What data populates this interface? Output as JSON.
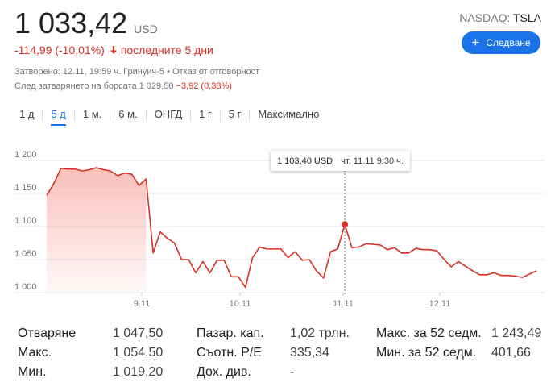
{
  "quote": {
    "price": "1 033,42",
    "currency": "USD",
    "exchange": "NASDAQ:",
    "symbol": "TSLA",
    "follow_label": "Следване",
    "change": "-114,99 (-10,01%)",
    "change_period": "последните 5 дни",
    "closed_note": "Затворено: 12.11, 19:59 ч. Гринуич-5 • Отказ от отговорност",
    "after_hours_label": "След затварянето на борсата 1 029,50",
    "after_hours_change": "−3,92 (0,38%)"
  },
  "tabs": [
    {
      "label": "1 д"
    },
    {
      "label": "5 д"
    },
    {
      "label": "1 м."
    },
    {
      "label": "6 м."
    },
    {
      "label": "ОНГД"
    },
    {
      "label": "1 г"
    },
    {
      "label": "5 г"
    },
    {
      "label": "Максимално"
    }
  ],
  "active_tab": 1,
  "tooltip": {
    "price": "1 103,40 USD",
    "date": "чт, 11.11 9:30 ч."
  },
  "chart_data": {
    "type": "area",
    "yticks": [
      "1 200",
      "1 150",
      "1 100",
      "1 050",
      "1 000"
    ],
    "ytick_values": [
      1200,
      1150,
      1100,
      1050,
      1000
    ],
    "xticks": [
      "9.11",
      "10.11",
      "11.11",
      "12.11"
    ],
    "ylim": [
      1000,
      1200
    ],
    "line_color": "#d93025",
    "highlight": {
      "label": "1 103,40 USD",
      "value": 1103.4
    },
    "series": [
      {
        "values": [
          1147,
          1165,
          1188,
          1187,
          1187,
          1184,
          1186,
          1189,
          1186,
          1184,
          1177,
          1181,
          1179,
          1162,
          1172,
          1060,
          1092,
          1082,
          1075,
          1050,
          1050,
          1030,
          1047,
          1030,
          1049,
          1049,
          1024,
          1024,
          1008,
          1053,
          1069,
          1066,
          1066,
          1066,
          1053,
          1062,
          1049,
          1050,
          1033,
          1022,
          1062,
          1066,
          1103.4,
          1068,
          1069,
          1074,
          1073,
          1072,
          1065,
          1068,
          1060,
          1060,
          1067,
          1065,
          1065,
          1063,
          1050,
          1039,
          1047,
          1040,
          1033,
          1027,
          1027,
          1030,
          1026,
          1026,
          1025,
          1023,
          1028,
          1033
        ]
      }
    ]
  },
  "stats": {
    "col1": [
      {
        "label": "Отваряне",
        "value": "1 047,50"
      },
      {
        "label": "Макс.",
        "value": "1 054,50"
      },
      {
        "label": "Мин.",
        "value": "1 019,20"
      }
    ],
    "col2": [
      {
        "label": "Пазар. кап.",
        "value": "1,02 трлн."
      },
      {
        "label": "Съотн. P/E",
        "value": "335,34"
      },
      {
        "label": "Дох. див.",
        "value": "-"
      }
    ],
    "col3": [
      {
        "label": "Макс. за 52 седм.",
        "value": "1 243,49"
      },
      {
        "label": "Мин. за 52 седм.",
        "value": "401,66"
      }
    ]
  }
}
